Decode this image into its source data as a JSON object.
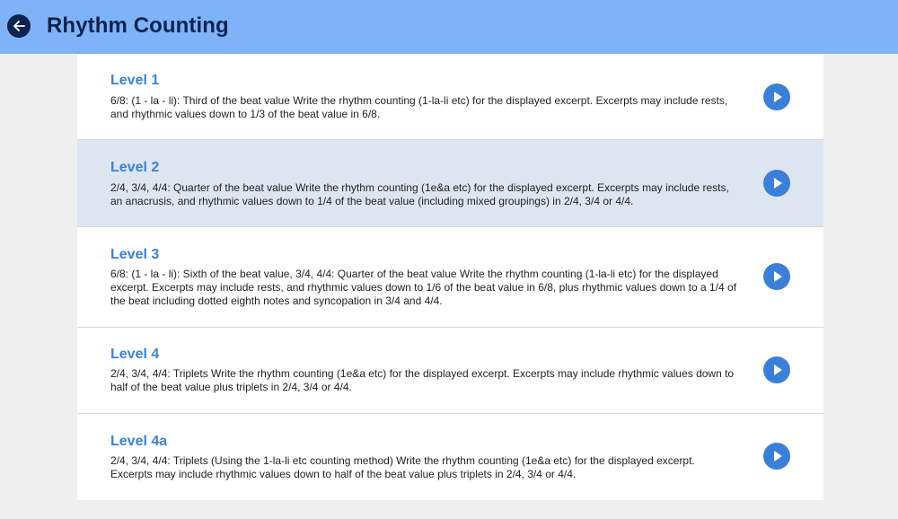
{
  "header": {
    "title": "Rhythm Counting",
    "back_icon": "arrow-left-icon",
    "background": "#7fb3f8",
    "title_color": "#0b2350"
  },
  "levels": [
    {
      "title": "Level 1",
      "description": "6/8: (1 - la - li): Third of the beat value Write the rhythm counting (1-la-li etc) for the displayed excerpt. Excerpts may include rests, and rhythmic values down to 1/3 of the beat value in 6/8.",
      "selected": false
    },
    {
      "title": "Level 2",
      "description": "2/4, 3/4, 4/4: Quarter of the beat value Write the rhythm counting (1e&a etc) for the displayed excerpt. Excerpts may include rests, an anacrusis, and rhythmic values down to 1/4 of the beat value (including mixed groupings) in 2/4, 3/4 or 4/4.",
      "selected": true
    },
    {
      "title": "Level 3",
      "description": "6/8: (1 - la - li): Sixth of the beat value, 3/4, 4/4: Quarter of the beat value Write the rhythm counting (1-la-li etc) for the displayed excerpt. Excerpts may include rests, and rhythmic values down to 1/6 of the beat value in 6/8, plus rhythmic values down to a 1/4 of the beat including dotted eighth notes and syncopation in 3/4 and 4/4.",
      "selected": false
    },
    {
      "title": "Level 4",
      "description": "2/4, 3/4, 4/4: Triplets Write the rhythm counting (1e&a etc) for the displayed excerpt. Excerpts may include rhythmic values down to half of the beat value plus triplets in 2/4, 3/4 or 4/4.",
      "selected": false
    },
    {
      "title": "Level 4a",
      "description": "2/4, 3/4, 4/4: Triplets (Using the 1-la-li etc counting method) Write the rhythm counting (1e&a etc) for the displayed excerpt. Excerpts may include rhythmic values down to half of the beat value plus triplets in 2/4, 3/4 or 4/4.",
      "selected": false
    }
  ],
  "play_icon": "play-icon",
  "accent_color": "#3a80d8",
  "selected_row_color": "#dde5f1"
}
